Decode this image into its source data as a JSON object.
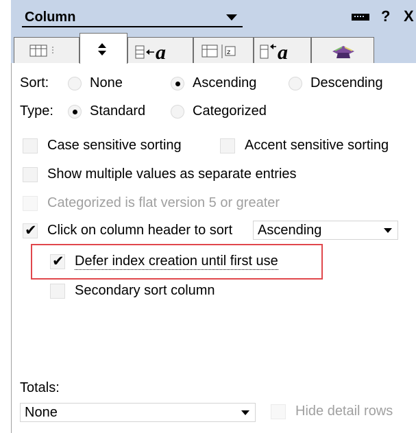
{
  "title": {
    "text": "Column"
  },
  "titlebar": {
    "pin_icon": "pin-icon",
    "help": "?",
    "close": "X"
  },
  "tabs": [
    {
      "name": "tab-basics",
      "icon": "column-properties-icon"
    },
    {
      "name": "tab-sorting",
      "icon": "sort-arrows-icon",
      "glyph": "⬍"
    },
    {
      "name": "tab-font",
      "icon": "column-font-icon"
    },
    {
      "name": "tab-number-format",
      "icon": "number-format-icon"
    },
    {
      "name": "tab-header-font",
      "icon": "header-font-icon"
    },
    {
      "name": "tab-advanced",
      "icon": "advanced-hat-icon"
    }
  ],
  "sort": {
    "label": "Sort:",
    "options": [
      "None",
      "Ascending",
      "Descending"
    ],
    "selected": "Ascending"
  },
  "type": {
    "label": "Type:",
    "options": [
      "Standard",
      "Categorized"
    ],
    "selected": "Standard"
  },
  "checks": {
    "case_sensitive": {
      "label": "Case sensitive sorting",
      "checked": false
    },
    "accent_sensitive": {
      "label": "Accent sensitive sorting",
      "checked": false
    },
    "multi_values": {
      "label": "Show multiple values as separate entries",
      "checked": false
    },
    "flat_v5": {
      "label": "Categorized is flat version 5 or greater",
      "checked": false
    },
    "click_header": {
      "label": "Click on column header to sort",
      "checked": true,
      "mark": "✔"
    },
    "defer_index": {
      "label": "Defer index creation until first use",
      "checked": true,
      "mark": "✔"
    },
    "secondary_sort": {
      "label": "Secondary sort column",
      "checked": false
    },
    "hide_detail": {
      "label": "Hide detail rows",
      "checked": false
    }
  },
  "header_sort_select": {
    "value": "Ascending"
  },
  "totals": {
    "label": "Totals:",
    "value": "None"
  },
  "colors": {
    "titlebar": "#c6d4e8",
    "highlight": "#e0474c"
  }
}
